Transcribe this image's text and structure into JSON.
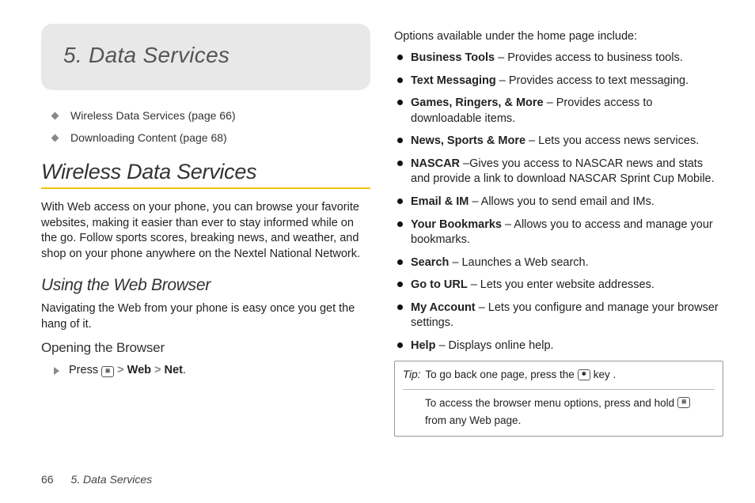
{
  "chapter": {
    "number": "5.",
    "title": "Data Services"
  },
  "toc": [
    "Wireless Data Services (page 66)",
    "Downloading Content (page 68)"
  ],
  "section": {
    "heading": "Wireless Data Services",
    "intro": "With Web access on your phone, you can browse your favorite websites, making it easier than ever to stay informed while on the go. Follow sports scores, breaking news, and weather, and shop on your phone anywhere on the Nextel National Network."
  },
  "sub": {
    "heading": "Using the Web Browser",
    "text": "Navigating the Web from your phone is easy once you get the hang of it."
  },
  "subsub": {
    "heading": "Opening the Browser",
    "step_press": "Press",
    "gt": ">",
    "web": "Web",
    "net": "Net",
    "dot": "."
  },
  "options": {
    "intro": "Options available under the home page include:",
    "items": [
      {
        "label": "Business Tools",
        "text": " – Provides access to business tools."
      },
      {
        "label": "Text Messaging",
        "text": " – Provides access to text messaging."
      },
      {
        "label": "Games, Ringers, & More",
        "text": " – Provides access to downloadable items."
      },
      {
        "label": "News, Sports & More",
        "text": " – Lets you access news services."
      },
      {
        "label": "NASCAR",
        "text": " –Gives you access to NASCAR news and stats and provide a link to download NASCAR Sprint Cup Mobile."
      },
      {
        "label": "Email & IM",
        "text": " – Allows you to send email and IMs."
      },
      {
        "label": "Your Bookmarks",
        "text": " – Allows you to access and manage your bookmarks."
      },
      {
        "label": "Search",
        "text": " – Launches a Web search."
      },
      {
        "label": "Go to URL",
        "text": " – Lets you enter website addresses."
      },
      {
        "label": "My Account",
        "text": " – Lets you configure and manage your browser settings."
      },
      {
        "label": "Help",
        "text": " – Displays online help."
      }
    ]
  },
  "tip": {
    "label": "Tip:",
    "row1_a": "To go back one page, press the",
    "row1_b": "key .",
    "row2_a": "To access the browser menu options, press and hold",
    "row2_b": "from any Web page."
  },
  "footer": {
    "page": "66",
    "chapter": "5. Data Services"
  },
  "icons": {
    "key_star": "✱",
    "key_grid": "⊞"
  }
}
